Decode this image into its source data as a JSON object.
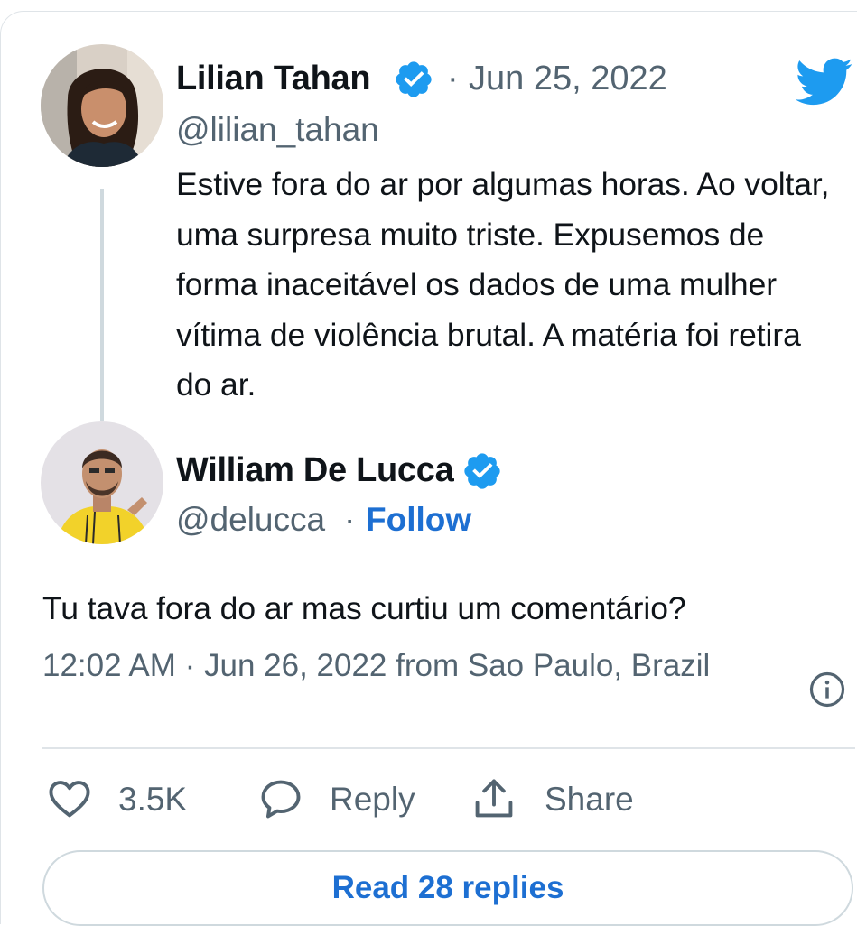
{
  "quoted_tweet": {
    "author_name": "Lilian Tahan",
    "separator": "·",
    "date": "Jun 25, 2022",
    "handle": "@lilian_tahan",
    "text": "Estive fora do ar por algumas horas. Ao voltar, uma surpresa muito triste. Expusemos de forma inaceitável os dados de uma mulher vítima de violência brutal. A matéria foi retira do ar."
  },
  "tweet": {
    "author_name": "William De Lucca",
    "handle": "@delucca",
    "separator": "·",
    "follow_label": "Follow",
    "text": "Tu tava fora do ar mas curtiu um comentário?",
    "timestamp": "12:02 AM · Jun 26, 2022 from Sao Paulo, Brazil"
  },
  "actions": {
    "like_count": "3.5K",
    "reply_label": "Reply",
    "share_label": "Share"
  },
  "read_replies_label": "Read 28 replies",
  "icons": {
    "brand": "twitter-bird-icon",
    "verified": "verified-badge-icon",
    "info": "info-icon",
    "like": "heart-icon",
    "reply": "speech-bubble-icon",
    "share": "share-icon"
  },
  "colors": {
    "twitter_blue": "#1d9bf0",
    "link_blue": "#1d6fd2",
    "muted_text": "#536471",
    "body_text": "#0f1419",
    "border": "#dfe4e8"
  }
}
